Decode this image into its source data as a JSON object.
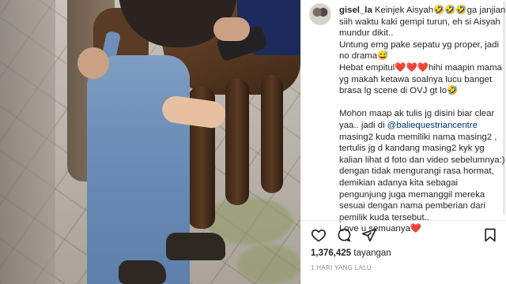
{
  "post": {
    "username": "gisel_la",
    "caption_segments": {
      "intro": " Keinjek Aisyah🤣🤣🤣ga janjian siih waktu kaki gempi turun, eh si Aisyah mundur dikit..\nUntung emg pake sepatu yg proper, jadi no drama😅\nHebat empitul❤️❤️❤️hihi maapin mama yg makah ketawa soalnya lucu banget brasa lg scene di OVJ gt lo🤣\n\nMohon maap ak tulis jg disini biar clear yaa.. jadi di ",
      "mention": "@baliequestriancentre",
      "outro": "\nmasing2 kuda memiliki nama masing2 , tertulis jg d kandang masing2 kyk yg kalian lihat d foto dan video sebelumnya:) dengan tidak mengurangi rasa hormat, demikian adanya kita sebagai pengunjung juga memanggil mereka sesuai dengan nama pemberian dari pemilik kuda tersebut..\nLove u semuanya❤️"
    },
    "views_count": "1,376,425",
    "views_label": "tayangan",
    "posted_ago": "1 HARI YANG LALU"
  },
  "icons": {
    "like": "heart-icon",
    "comment": "comment-icon",
    "share": "share-icon",
    "save": "bookmark-icon"
  },
  "colors": {
    "text": "#262626",
    "mention": "#00376b",
    "muted": "#8e8e8e",
    "divider": "#efefef"
  }
}
